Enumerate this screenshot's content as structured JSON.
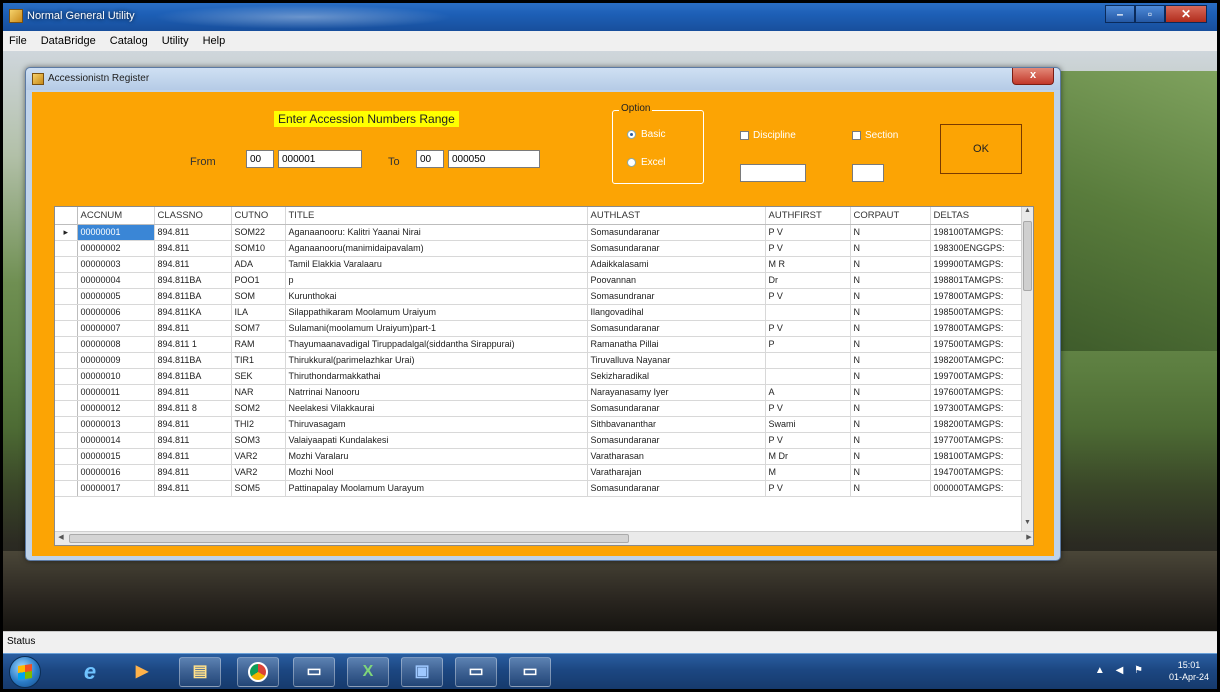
{
  "app": {
    "title": "Normal General Utility",
    "menu": [
      "File",
      "DataBridge",
      "Catalog",
      "Utility",
      "Help"
    ]
  },
  "window": {
    "title": "Accessionistn Register",
    "close_glyph": "x"
  },
  "form": {
    "heading": "Enter Accession Numbers Range",
    "from_label": "From",
    "to_label": "To",
    "from_prefix": "00",
    "from_value": "000001",
    "to_prefix": "00",
    "to_value": "000050",
    "option_legend": "Option",
    "option_basic": "Basic",
    "option_excel": "Excel",
    "option_selected": "Basic",
    "discipline_label": "Discipline",
    "section_label": "Section",
    "discipline_value": "",
    "section_value": "",
    "ok_label": "OK"
  },
  "grid": {
    "columns": [
      "ACCNUM",
      "CLASSNO",
      "CUTNO",
      "TITLE",
      "AUTHLAST",
      "AUTHFIRST",
      "CORPAUT",
      "DELTAS"
    ],
    "rows": [
      [
        "00000001",
        "894.811",
        "SOM22",
        "Aganaanooru: Kalitri Yaanai Nirai",
        "Somasundaranar",
        "P V",
        "N",
        "198100TAMGPS:"
      ],
      [
        "00000002",
        "894.811",
        "SOM10",
        "Aganaanooru(manimidaipavalam)",
        "Somasundaranar",
        "P V",
        "N",
        "198300ENGGPS:"
      ],
      [
        "00000003",
        "894.811",
        "ADA",
        "Tamil Elakkia Varalaaru",
        "Adaikkalasami",
        "M R",
        "N",
        "199900TAMGPS:"
      ],
      [
        "00000004",
        "894.811BA",
        "POO1",
        "p",
        "Poovannan",
        "Dr",
        "N",
        "198801TAMGPS:"
      ],
      [
        "00000005",
        "894.811BA",
        "SOM",
        "Kurunthokai",
        "Somasundranar",
        "P V",
        "N",
        "197800TAMGPS:"
      ],
      [
        "00000006",
        "894.811KA",
        "ILA",
        "Silappathikaram Moolamum Uraiyum",
        "Ilangovadihal",
        "",
        "N",
        "198500TAMGPS:"
      ],
      [
        "00000007",
        "894.811",
        "SOM7",
        "Sulamani(moolamum Uraiyum)part-1",
        "Somasundaranar",
        "P V",
        "N",
        "197800TAMGPS:"
      ],
      [
        "00000008",
        "894.811 1",
        "RAM",
        "Thayumaanavadigal Tiruppadalgal(siddantha Sirappurai)",
        "Ramanatha Pillai",
        "P",
        "N",
        "197500TAMGPS:"
      ],
      [
        "00000009",
        "894.811BA",
        "TIR1",
        "Thirukkural(parimelazhkar Urai)",
        "Tiruvalluva Nayanar",
        "",
        "N",
        "198200TAMGPC:"
      ],
      [
        "00000010",
        "894.811BA",
        "SEK",
        "Thiruthondarmakkathai",
        "Sekizharadikal",
        "",
        "N",
        "199700TAMGPS:"
      ],
      [
        "00000011",
        "894.811",
        "NAR",
        "Natrrinai Nanooru",
        "Narayanasamy Iyer",
        "A",
        "N",
        "197600TAMGPS:"
      ],
      [
        "00000012",
        "894.811 8",
        "SOM2",
        "Neelakesi Vilakkaurai",
        "Somasundaranar",
        "P V",
        "N",
        "197300TAMGPS:"
      ],
      [
        "00000013",
        "894.811",
        "THI2",
        "Thiruvasagam",
        "Sithbavananthar",
        "Swami",
        "N",
        "198200TAMGPS:"
      ],
      [
        "00000014",
        "894.811",
        "SOM3",
        "Valaiyaapati Kundalakesi",
        "Somasundaranar",
        "P V",
        "N",
        "197700TAMGPS:"
      ],
      [
        "00000015",
        "894.811",
        "VAR2",
        "Mozhi Varalaru",
        "Varatharasan",
        "M Dr",
        "N",
        "198100TAMGPS:"
      ],
      [
        "00000016",
        "894.811",
        "VAR2",
        "Mozhi Nool",
        "Varatharajan",
        "M",
        "N",
        "194700TAMGPS:"
      ],
      [
        "00000017",
        "894.811",
        "SOM5",
        "Pattinapalay Moolamum Uarayum",
        "Somasundaranar",
        "P V",
        "N",
        "000000TAMGPS:"
      ]
    ],
    "selected_row": 0
  },
  "status": {
    "text": "Status"
  },
  "taskbar": {
    "apps": [
      "ie-icon",
      "media-player-icon",
      "folder-icon",
      "chrome-icon",
      "window-icon",
      "excel-icon",
      "app-icon",
      "window-icon",
      "window-icon"
    ],
    "time": "15:01",
    "date": "01-Apr-24"
  },
  "colors": {
    "form_bg": "#fca404",
    "heading_bg": "#ffff00",
    "selection": "#3a86d6"
  }
}
